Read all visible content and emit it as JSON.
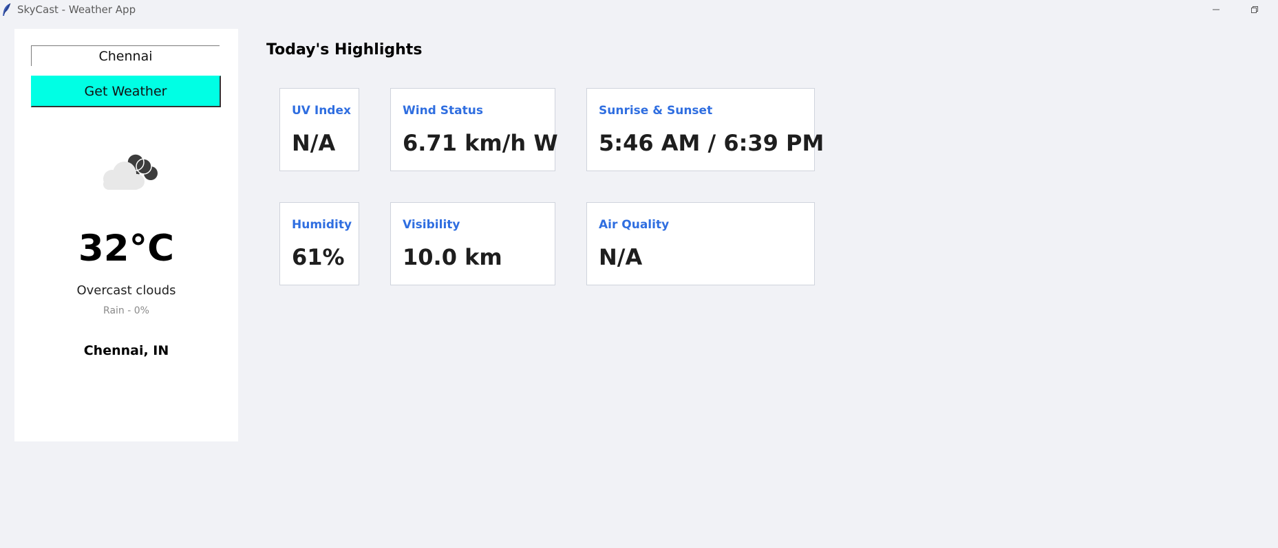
{
  "window": {
    "title": "SkyCast - Weather App",
    "icons": {
      "app": "feather-icon",
      "minimize": "minimize-icon",
      "restore": "restore-icon"
    }
  },
  "search": {
    "city_value": "Chennai",
    "button_label": "Get Weather"
  },
  "current": {
    "icon": "overcast-cloud-icon",
    "temperature": "32°C",
    "condition": "Overcast clouds",
    "rain": "Rain - 0%",
    "location": "Chennai, IN"
  },
  "highlights": {
    "title": "Today's Highlights",
    "cards": [
      {
        "label": "UV Index",
        "value": "N/A"
      },
      {
        "label": "Wind Status",
        "value": "6.71 km/h W"
      },
      {
        "label": "Sunrise & Sunset",
        "value": "5:46 AM / 6:39 PM"
      },
      {
        "label": "Humidity",
        "value": "61%"
      },
      {
        "label": "Visibility",
        "value": "10.0 km"
      },
      {
        "label": "Air Quality",
        "value": "N/A"
      }
    ]
  },
  "colors": {
    "background": "#f1f2f6",
    "button": "#00ffe4",
    "card_label": "#2f6ee0",
    "panel": "#ffffff"
  }
}
